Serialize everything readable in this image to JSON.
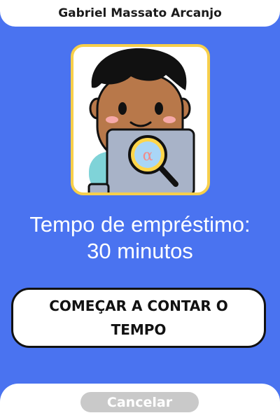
{
  "header": {
    "user_name": "Gabriel Massato Arcanjo"
  },
  "avatar": {
    "icon": "person-with-laptop-and-magnifier-icon"
  },
  "loan": {
    "line1": "Tempo de empréstimo:",
    "line2": "30 minutos"
  },
  "actions": {
    "start_label": "COMEÇAR A CONTAR O TEMPO",
    "cancel_label": "Cancelar"
  },
  "colors": {
    "background": "#4a73f0",
    "frame_border": "#f7cf4a",
    "cancel_bg": "#c9c9c9"
  }
}
